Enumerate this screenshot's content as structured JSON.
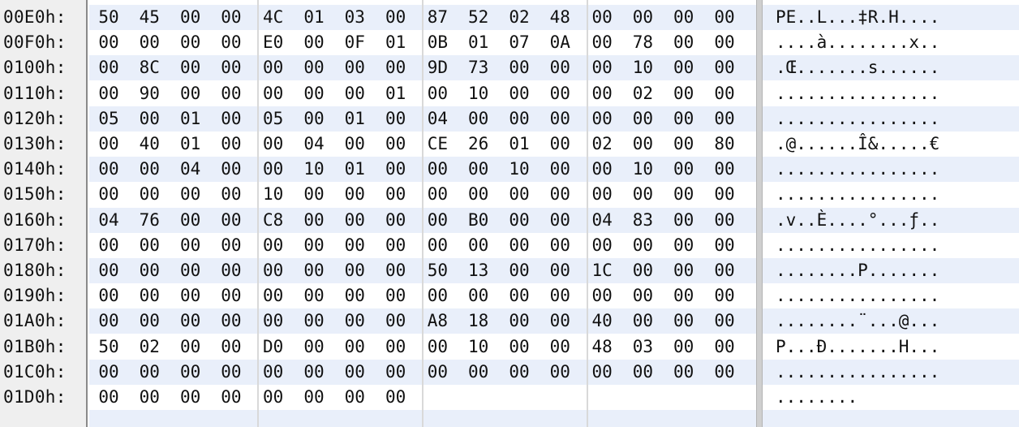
{
  "colors": {
    "band_blue": "#e9effa",
    "band_white": "#ffffff",
    "address_bg": "#efefef",
    "text": "#111111"
  },
  "rows": [
    {
      "address": "00E0h:",
      "bytes": [
        "50",
        "45",
        "00",
        "00",
        "4C",
        "01",
        "03",
        "00",
        "87",
        "52",
        "02",
        "48",
        "00",
        "00",
        "00",
        "00"
      ],
      "ascii": "PE..L...‡R.H...."
    },
    {
      "address": "00F0h:",
      "bytes": [
        "00",
        "00",
        "00",
        "00",
        "E0",
        "00",
        "0F",
        "01",
        "0B",
        "01",
        "07",
        "0A",
        "00",
        "78",
        "00",
        "00"
      ],
      "ascii": "....à........x.."
    },
    {
      "address": "0100h:",
      "bytes": [
        "00",
        "8C",
        "00",
        "00",
        "00",
        "00",
        "00",
        "00",
        "9D",
        "73",
        "00",
        "00",
        "00",
        "10",
        "00",
        "00"
      ],
      "ascii": ".Œ.......s......"
    },
    {
      "address": "0110h:",
      "bytes": [
        "00",
        "90",
        "00",
        "00",
        "00",
        "00",
        "00",
        "01",
        "00",
        "10",
        "00",
        "00",
        "00",
        "02",
        "00",
        "00"
      ],
      "ascii": "................"
    },
    {
      "address": "0120h:",
      "bytes": [
        "05",
        "00",
        "01",
        "00",
        "05",
        "00",
        "01",
        "00",
        "04",
        "00",
        "00",
        "00",
        "00",
        "00",
        "00",
        "00"
      ],
      "ascii": "................"
    },
    {
      "address": "0130h:",
      "bytes": [
        "00",
        "40",
        "01",
        "00",
        "00",
        "04",
        "00",
        "00",
        "CE",
        "26",
        "01",
        "00",
        "02",
        "00",
        "00",
        "80"
      ],
      "ascii": ".@......Î&.....€"
    },
    {
      "address": "0140h:",
      "bytes": [
        "00",
        "00",
        "04",
        "00",
        "00",
        "10",
        "01",
        "00",
        "00",
        "00",
        "10",
        "00",
        "00",
        "10",
        "00",
        "00"
      ],
      "ascii": "................"
    },
    {
      "address": "0150h:",
      "bytes": [
        "00",
        "00",
        "00",
        "00",
        "10",
        "00",
        "00",
        "00",
        "00",
        "00",
        "00",
        "00",
        "00",
        "00",
        "00",
        "00"
      ],
      "ascii": "................"
    },
    {
      "address": "0160h:",
      "bytes": [
        "04",
        "76",
        "00",
        "00",
        "C8",
        "00",
        "00",
        "00",
        "00",
        "B0",
        "00",
        "00",
        "04",
        "83",
        "00",
        "00"
      ],
      "ascii": ".v..È....°...ƒ.."
    },
    {
      "address": "0170h:",
      "bytes": [
        "00",
        "00",
        "00",
        "00",
        "00",
        "00",
        "00",
        "00",
        "00",
        "00",
        "00",
        "00",
        "00",
        "00",
        "00",
        "00"
      ],
      "ascii": "................"
    },
    {
      "address": "0180h:",
      "bytes": [
        "00",
        "00",
        "00",
        "00",
        "00",
        "00",
        "00",
        "00",
        "50",
        "13",
        "00",
        "00",
        "1C",
        "00",
        "00",
        "00"
      ],
      "ascii": "........P......."
    },
    {
      "address": "0190h:",
      "bytes": [
        "00",
        "00",
        "00",
        "00",
        "00",
        "00",
        "00",
        "00",
        "00",
        "00",
        "00",
        "00",
        "00",
        "00",
        "00",
        "00"
      ],
      "ascii": "................"
    },
    {
      "address": "01A0h:",
      "bytes": [
        "00",
        "00",
        "00",
        "00",
        "00",
        "00",
        "00",
        "00",
        "A8",
        "18",
        "00",
        "00",
        "40",
        "00",
        "00",
        "00"
      ],
      "ascii": "........¨...@..."
    },
    {
      "address": "01B0h:",
      "bytes": [
        "50",
        "02",
        "00",
        "00",
        "D0",
        "00",
        "00",
        "00",
        "00",
        "10",
        "00",
        "00",
        "48",
        "03",
        "00",
        "00"
      ],
      "ascii": "P...Ð.......H..."
    },
    {
      "address": "01C0h:",
      "bytes": [
        "00",
        "00",
        "00",
        "00",
        "00",
        "00",
        "00",
        "00",
        "00",
        "00",
        "00",
        "00",
        "00",
        "00",
        "00",
        "00"
      ],
      "ascii": "................"
    },
    {
      "address": "01D0h:",
      "bytes": [
        "00",
        "00",
        "00",
        "00",
        "00",
        "00",
        "00",
        "00"
      ],
      "ascii": "........"
    }
  ]
}
